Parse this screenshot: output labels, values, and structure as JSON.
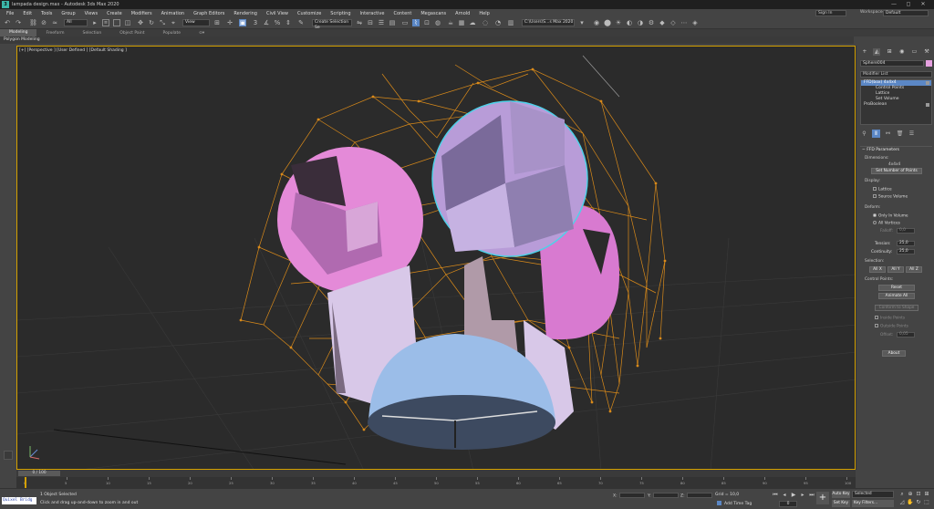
{
  "window": {
    "title": "lampada design.max - Autodesk 3ds Max 2020",
    "controls": [
      "—",
      "◻",
      "✕"
    ]
  },
  "menu": [
    "File",
    "Edit",
    "Tools",
    "Group",
    "Views",
    "Create",
    "Modifiers",
    "Animation",
    "Graph Editors",
    "Rendering",
    "Civil View",
    "Customize",
    "Scripting",
    "Interactive",
    "Content",
    "Megascans",
    "Arnold",
    "Help"
  ],
  "account": {
    "signin": "Sign In",
    "workspace_label": "Workspaces:",
    "workspace_value": "Default"
  },
  "toolbar": {
    "view_dropdown": "View",
    "all_filter": "All",
    "selection_set": "Create Selection Se",
    "path": "C:\\Users\\S...s Max 2020"
  },
  "ribbon": {
    "tabs": [
      "Modeling",
      "Freeform",
      "Selection",
      "Object Paint",
      "Populate"
    ],
    "sub": "Polygon Modeling"
  },
  "viewport": {
    "label": "[+] [Perspective ] [User Defined ] [Default Shading ]"
  },
  "panel": {
    "object_name": "Sphere004",
    "modifier_list": "Modifier List",
    "stack": [
      {
        "label": "FFD(box) 4x4x4",
        "sel": true,
        "sub": false
      },
      {
        "label": "Control Points",
        "sel": false,
        "sub": true
      },
      {
        "label": "Lattice",
        "sel": false,
        "sub": true
      },
      {
        "label": "Set Volume",
        "sel": false,
        "sub": true
      },
      {
        "label": "ProBoolean",
        "sel": false,
        "sub": false
      }
    ],
    "rollout_title": "FFD Parameters",
    "dimensions_label": "Dimensions:",
    "dimensions_value": "4x4x4",
    "set_points": "Set Number of Points",
    "display_label": "Display:",
    "lattice": "Lattice",
    "source_volume": "Source Volume",
    "deform_label": "Deform:",
    "only_in_volume": "Only In Volume",
    "all_vertices": "All Vertices",
    "falloff_label": "Falloff:",
    "falloff_value": "0,0",
    "tension_label": "Tension:",
    "tension_value": "25,0",
    "continuity_label": "Continuity:",
    "continuity_value": "25,0",
    "selection_label": "Selection:",
    "all_x": "All X",
    "all_y": "All Y",
    "all_z": "All Z",
    "control_points_label": "Control Points:",
    "reset": "Reset",
    "animate_all": "Animate All",
    "conform": "Conform to Shape",
    "inside_points": "Inside Points",
    "outside_points": "Outside Points",
    "offset_label": "Offset:",
    "offset_value": "0,05",
    "about": "About"
  },
  "timeline": {
    "slider": "0 / 100",
    "ticks": [
      "0",
      "5",
      "10",
      "15",
      "20",
      "25",
      "30",
      "35",
      "40",
      "45",
      "50",
      "55",
      "60",
      "65",
      "70",
      "75",
      "80",
      "85",
      "90",
      "95",
      "100"
    ]
  },
  "status": {
    "maxscript": "Quixel Bridg",
    "line1": "1 Object Selected",
    "line2": "Click and drag up-and-down to zoom in and out",
    "x_label": "X:",
    "y_label": "Y:",
    "z_label": "Z:",
    "grid": "Grid = 10,0",
    "add_time_tag": "Add Time Tag",
    "frame": "0",
    "auto_key": "Auto Key",
    "set_key": "Set Key",
    "selected": "Selected",
    "key_filters": "Key Filters..."
  }
}
